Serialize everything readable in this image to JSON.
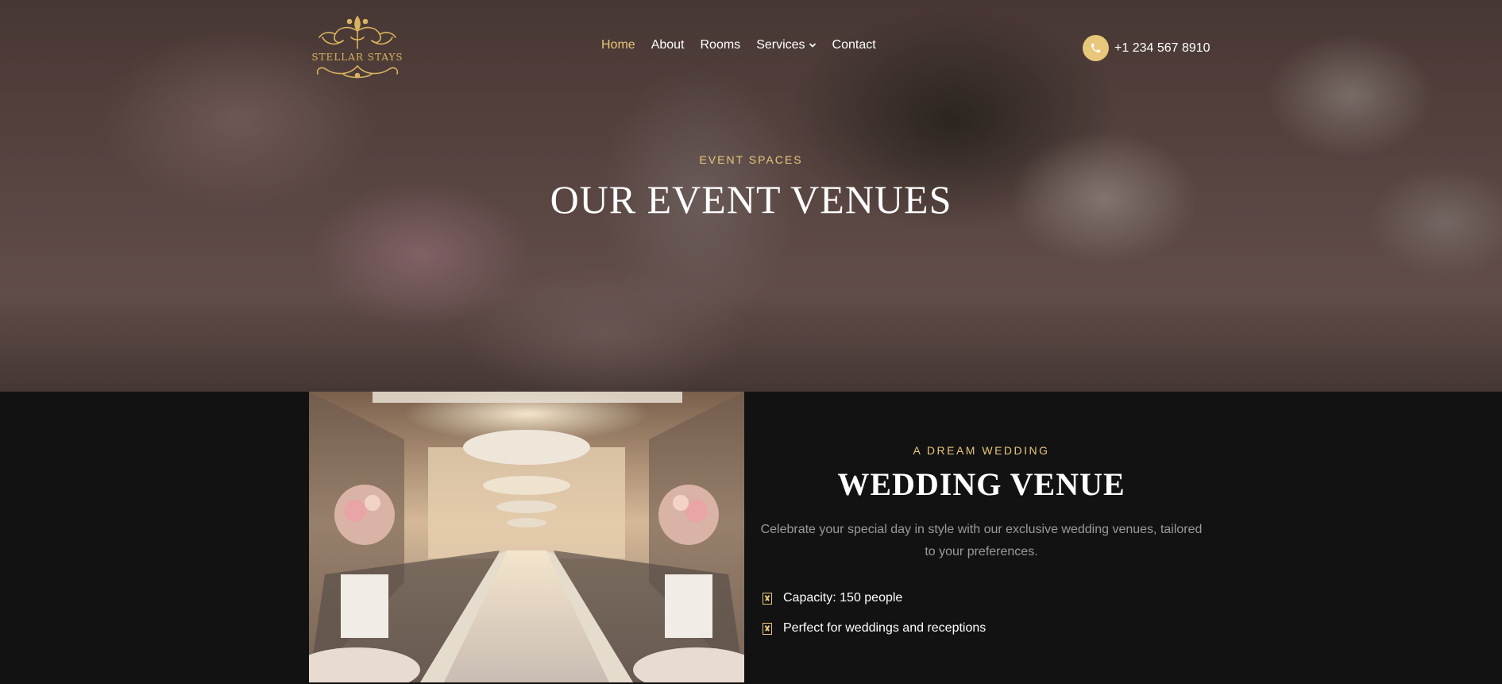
{
  "brand": {
    "name": "STELLAR STAYS",
    "logo_icon": "ornament-crest-icon",
    "accent": "#e8c77a"
  },
  "nav": {
    "items": [
      {
        "label": "Home",
        "active": true
      },
      {
        "label": "About"
      },
      {
        "label": "Rooms"
      },
      {
        "label": "Services",
        "has_dropdown": true
      },
      {
        "label": "Contact"
      }
    ]
  },
  "contact": {
    "phone": "+1 234 567 8910",
    "icon": "phone-icon"
  },
  "hero": {
    "eyebrow": "EVENT SPACES",
    "title": "OUR EVENT VENUES"
  },
  "venue": {
    "eyebrow": "A DREAM WEDDING",
    "title": "WEDDING VENUE",
    "description": "Celebrate your special day in style with our exclusive wedding venues, tailored to your preferences.",
    "features": [
      {
        "text": "Capacity: 150 people",
        "icon": "checkbox-x-icon"
      },
      {
        "text": "Perfect for weddings and receptions",
        "icon": "checkbox-x-icon"
      }
    ]
  }
}
